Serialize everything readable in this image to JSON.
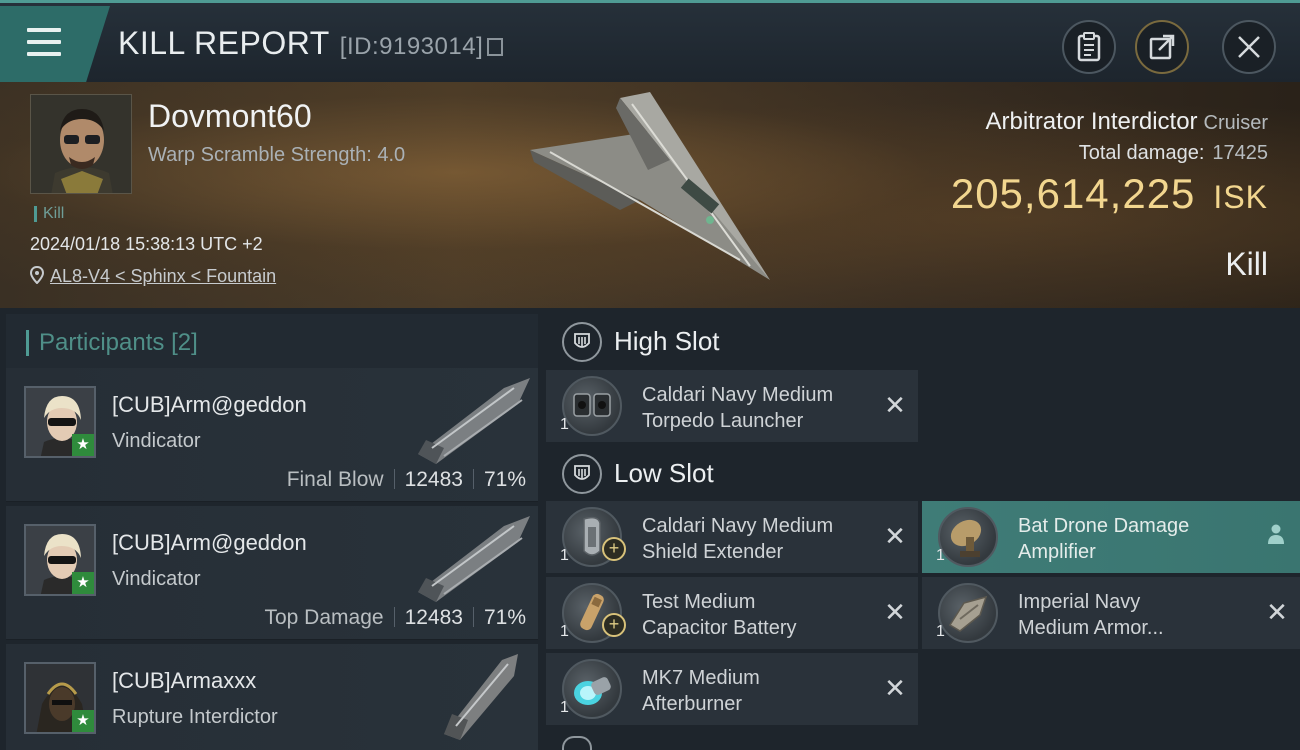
{
  "header": {
    "title": "KILL REPORT",
    "report_id": "[ID:9193014]",
    "menu_icon": "hamburger-menu-icon",
    "actions": [
      {
        "name": "clipboard",
        "icon": "clipboard-icon"
      },
      {
        "name": "share",
        "icon": "share-icon"
      },
      {
        "name": "close",
        "icon": "close-icon"
      }
    ]
  },
  "victim": {
    "pilot_name": "Dovmont60",
    "warp_scramble": "Warp Scramble Strength: 4.0",
    "kill_tag": "Kill",
    "datetime": "2024/01/18 15:38:13 UTC +2",
    "location": "AL8-V4 < Sphinx < Fountain",
    "ship_name": "Arbitrator Interdictor",
    "ship_class": "Cruiser",
    "total_damage_label": "Total damage:",
    "total_damage_value": "17425",
    "isk_value": "205,614,225",
    "isk_unit": "ISK",
    "result": "Kill"
  },
  "participants": {
    "title": "Participants",
    "count": "[2]",
    "items": [
      {
        "name": "[CUB]Arm@geddon",
        "ship": "Vindicator",
        "role": "Final Blow",
        "damage": "12483",
        "percent": "71%"
      },
      {
        "name": "[CUB]Arm@geddon",
        "ship": "Vindicator",
        "role": "Top Damage",
        "damage": "12483",
        "percent": "71%"
      },
      {
        "name": "[CUB]Armaxxx",
        "ship": "Rupture Interdictor",
        "role": "",
        "damage": "",
        "percent": ""
      }
    ]
  },
  "fitting": {
    "high_slot_title": "High Slot",
    "low_slot_title": "Low Slot",
    "high_slot": [
      {
        "line1": "Caldari Navy Medium",
        "line2": "Torpedo Launcher",
        "qty": "1"
      }
    ],
    "low_slot": [
      {
        "line1": "Caldari Navy Medium",
        "line2": "Shield Extender",
        "qty": "1"
      },
      {
        "line1": "Bat Drone Damage",
        "line2": "Amplifier",
        "qty": "1"
      },
      {
        "line1": "Test Medium",
        "line2": "Capacitor Battery",
        "qty": "1"
      },
      {
        "line1": "Imperial Navy",
        "line2": "Medium Armor...",
        "qty": "1"
      },
      {
        "line1": "MK7 Medium",
        "line2": "Afterburner",
        "qty": "1"
      }
    ],
    "remove_glyph": "✕",
    "colors": {
      "accent": "#4f9b94",
      "isk": "#f2d68f",
      "highlight": "#3f7c77"
    }
  }
}
